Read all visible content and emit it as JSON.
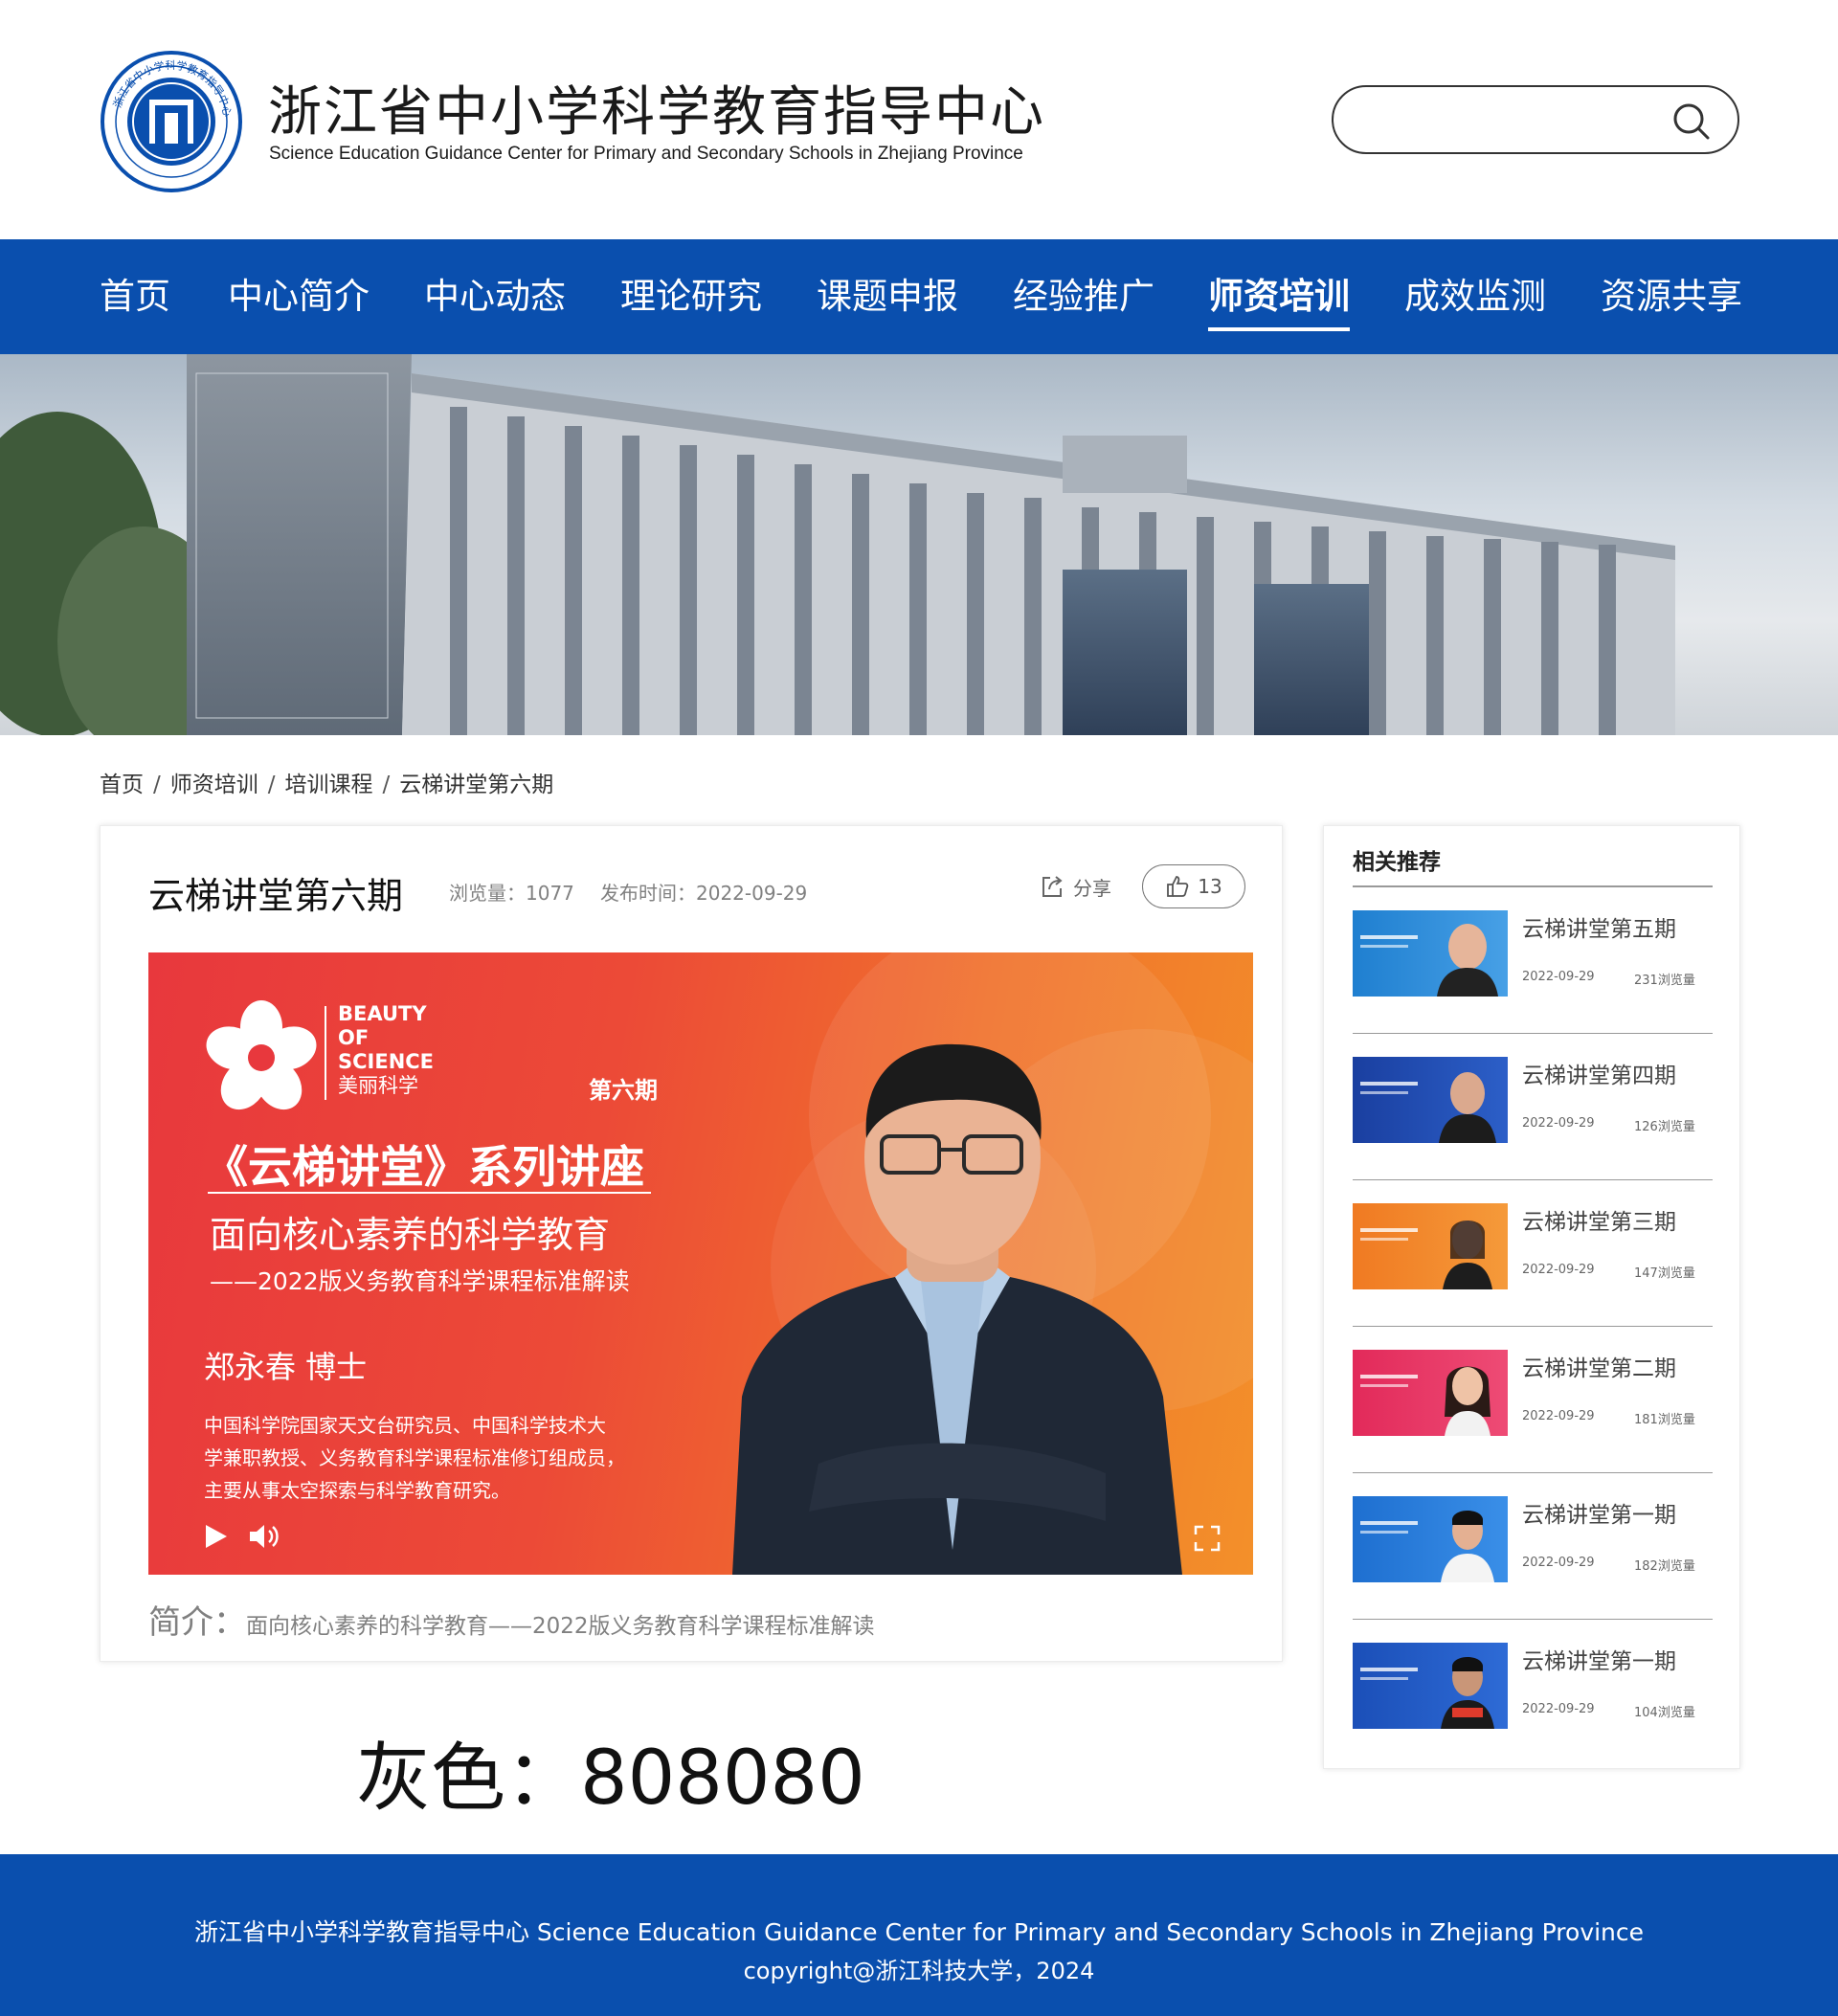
{
  "header": {
    "title": "浙江省中小学科学教育指导中心",
    "subtitle": "Science Education Guidance Center for Primary and Secondary Schools in Zhejiang Province",
    "logo_text": "浙江省中小学科学教育指导中心",
    "search": {
      "placeholder": "",
      "icon": "search-icon"
    }
  },
  "nav": {
    "items": [
      {
        "label": "首页"
      },
      {
        "label": "中心简介"
      },
      {
        "label": "中心动态"
      },
      {
        "label": "理论研究"
      },
      {
        "label": "课题申报"
      },
      {
        "label": "经验推广"
      },
      {
        "label": "师资培训",
        "active": true
      },
      {
        "label": "成效监测"
      },
      {
        "label": "资源共享"
      }
    ],
    "bg_color": "#0a4fae"
  },
  "breadcrumb": {
    "items": [
      "首页",
      "师资培训",
      "培训课程",
      "云梯讲堂第六期"
    ],
    "separator": "/"
  },
  "article": {
    "title": "云梯讲堂第六期",
    "views": "浏览量：1077",
    "date": "发布时间：2022-09-29",
    "share_label": "分享",
    "like_count": "13",
    "video": {
      "brand_en_1": "BEAUTY",
      "brand_en_2": "OF",
      "brand_en_3": "SCIENCE",
      "brand_cn": "美丽科学",
      "issue": "第六期",
      "series": "《云梯讲堂》系列讲座",
      "topic": "面向核心素养的科学教育",
      "subtopic": "——2022版义务教育科学课程标准解读",
      "speaker": "郑永春 博士",
      "bio_1": "中国科学院国家天文台研究员、中国科学技术大",
      "bio_2": "学兼职教授、义务教育科学课程标准修订组成员，",
      "bio_3": "主要从事太空探索与科学教育研究。"
    },
    "intro_label": "简介：",
    "intro_text": "面向核心素养的科学教育——2022版义务教育科学课程标准解读"
  },
  "annotation": "灰色：808080",
  "sidebar": {
    "title": "相关推荐",
    "items": [
      {
        "title": "云梯讲堂第五期",
        "date": "2022-09-29",
        "views": "231浏览量",
        "color": "#1f7fd0"
      },
      {
        "title": "云梯讲堂第四期",
        "date": "2022-09-29",
        "views": "126浏览量",
        "color": "#1a3fa0"
      },
      {
        "title": "云梯讲堂第三期",
        "date": "2022-09-29",
        "views": "147浏览量",
        "color": "#f07a22"
      },
      {
        "title": "云梯讲堂第二期",
        "date": "2022-09-29",
        "views": "181浏览量",
        "color": "#e22a5a"
      },
      {
        "title": "云梯讲堂第一期",
        "date": "2022-09-29",
        "views": "182浏览量",
        "color": "#1e6fd0"
      },
      {
        "title": "云梯讲堂第一期",
        "date": "2022-09-29",
        "views": "104浏览量",
        "color": "#1b4fb8"
      }
    ]
  },
  "footer": {
    "line1": "浙江省中小学科学教育指导中心  Science Education Guidance Center for Primary and Secondary Schools in Zhejiang Province",
    "line2": "copyright@浙江科技大学，2024"
  },
  "colors": {
    "primary": "#0a4fae",
    "grey": "#808080"
  }
}
